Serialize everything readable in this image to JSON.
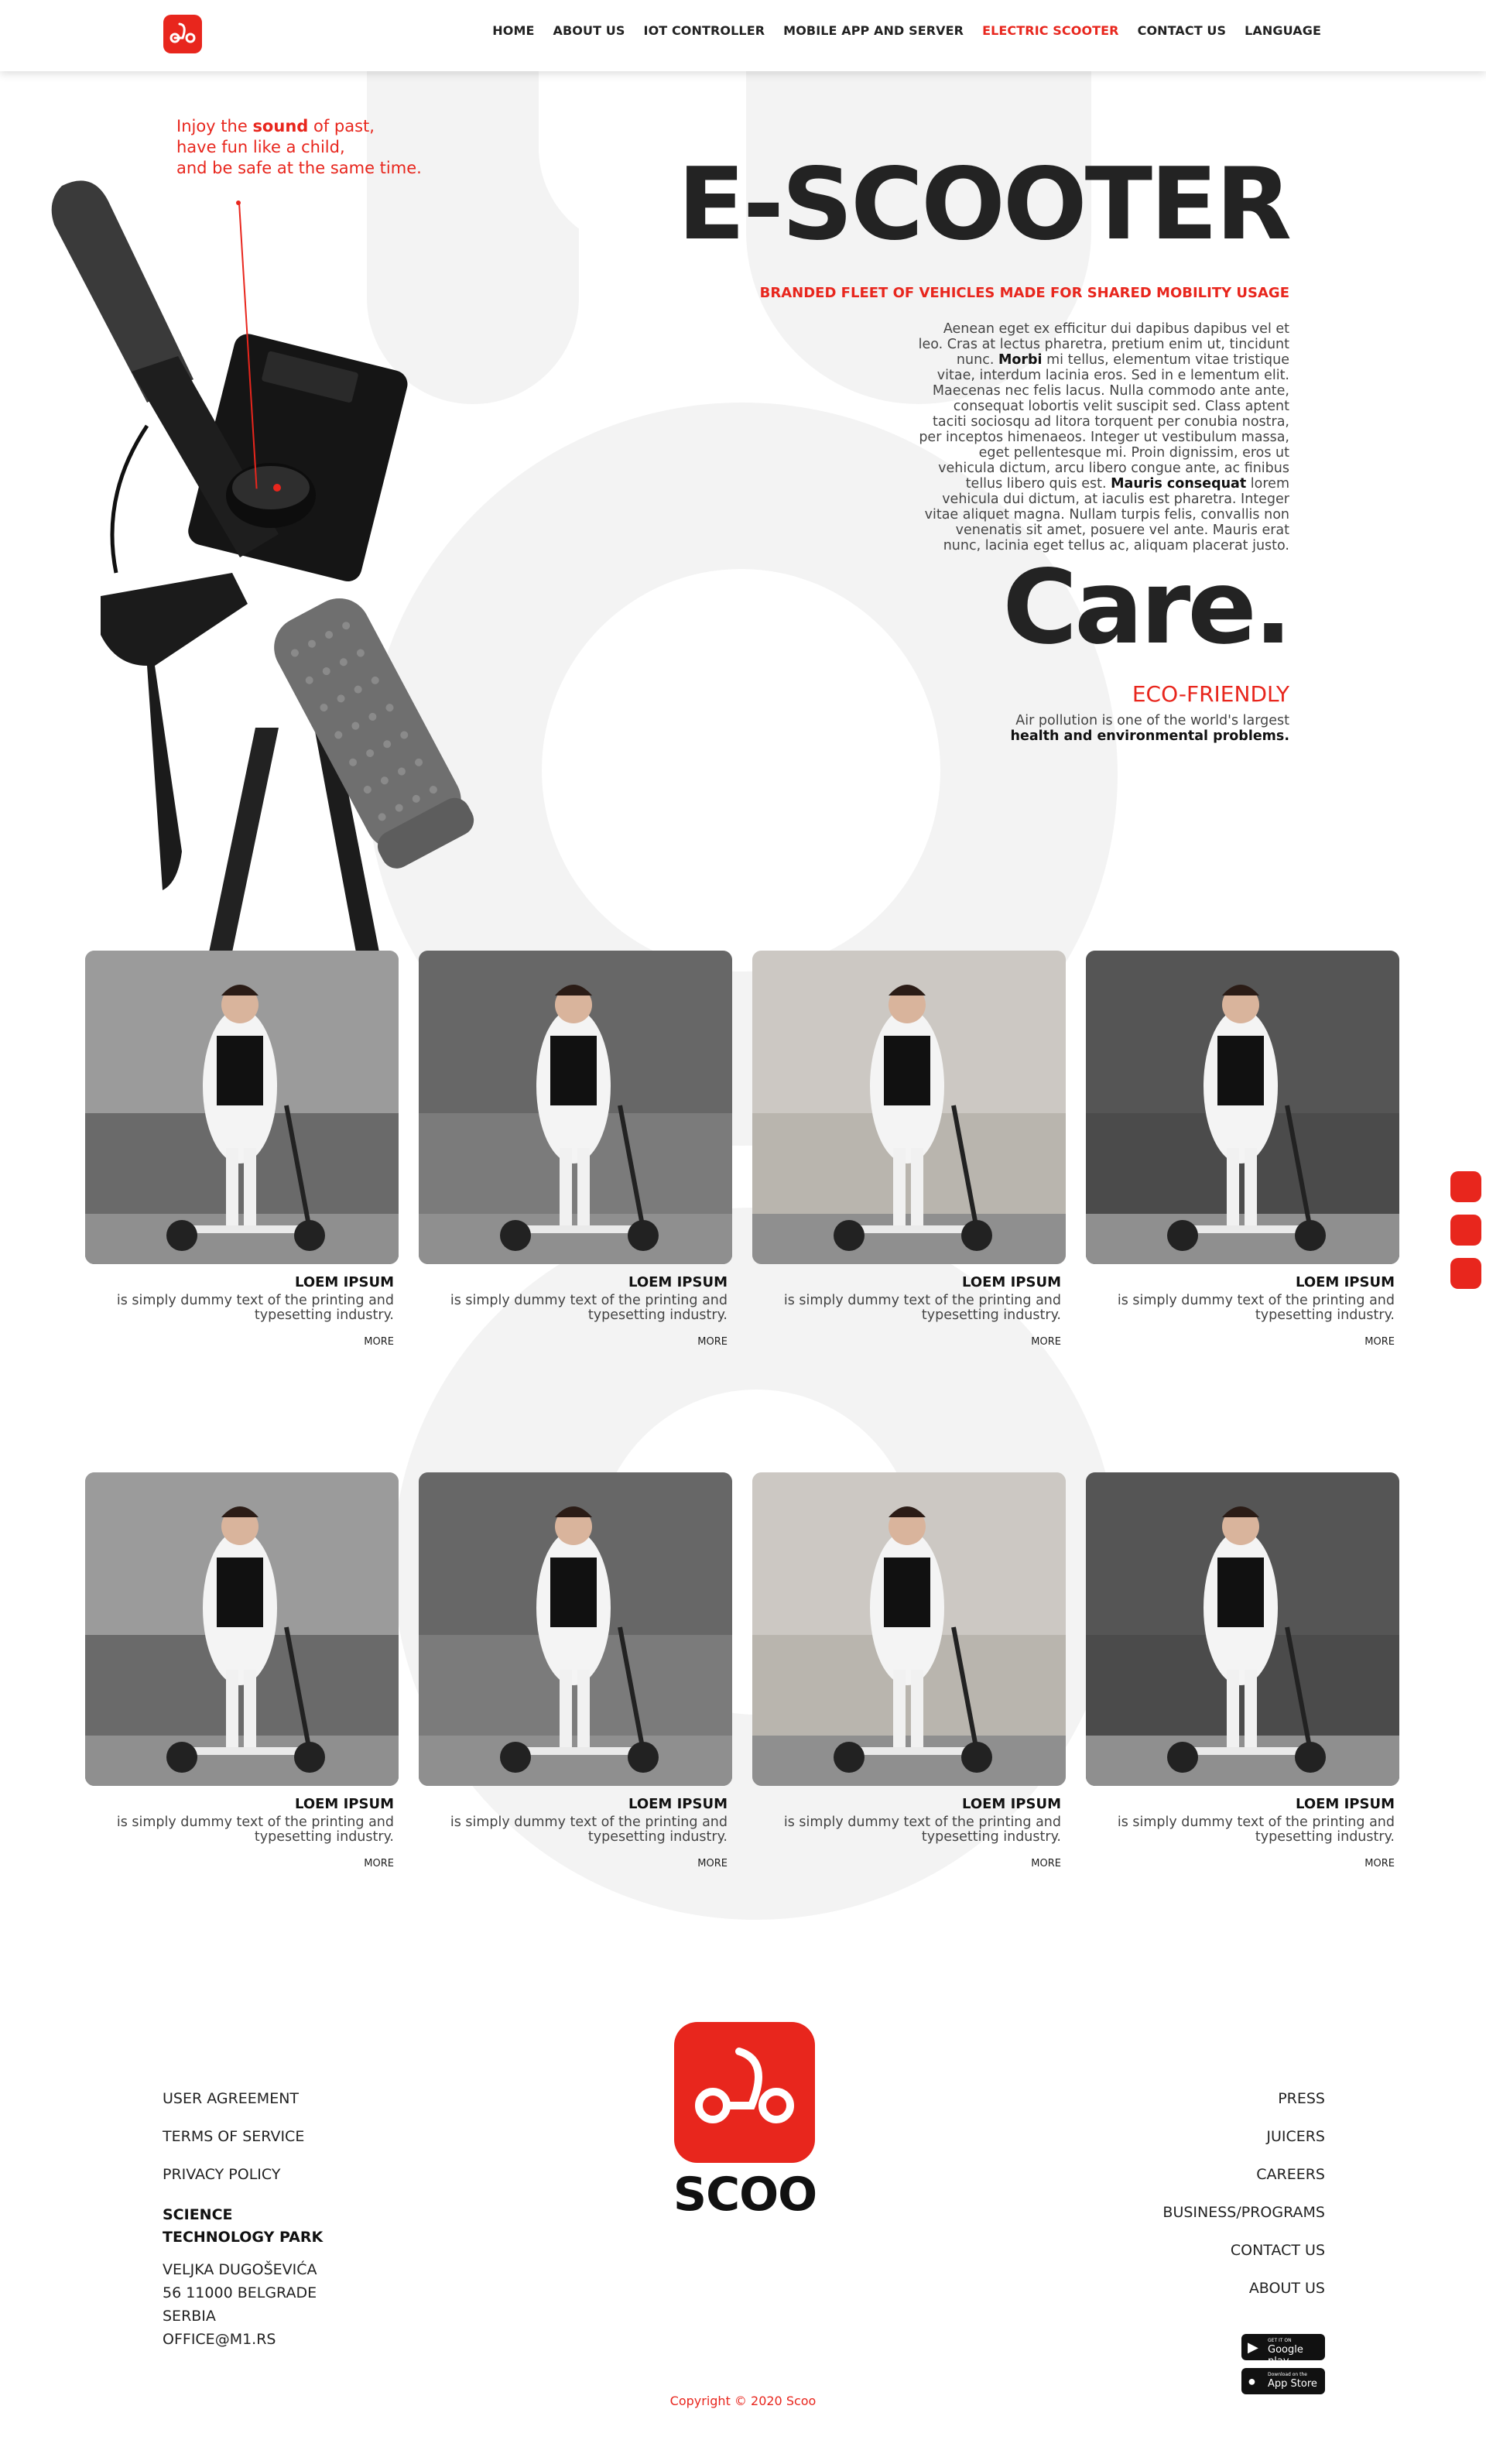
{
  "nav": [
    "HOME",
    "ABOUT US",
    "IOT CONTROLLER",
    "MOBILE APP AND SERVER",
    "ELECTRIC SCOOTER",
    "CONTACT US",
    "LANGUAGE"
  ],
  "nav_active": "ELECTRIC SCOOTER",
  "colors": {
    "accent": "#e8261d",
    "text": "#232323",
    "watermark": "#f3f3f3"
  },
  "tagline": {
    "line1_pre": "Injoy the ",
    "line1_bold": "sound",
    "line1_post": " of past,",
    "line2": "have fun like a child,",
    "line3": "and be safe at the same time."
  },
  "hero": {
    "title": "E-SCOOTER",
    "subtitle": "BRANDED FLEET OF VEHICLES MADE FOR SHARED MOBILITY USAGE",
    "p1": "Aenean eget ex efficitur dui dapibus dapibus vel et leo. Cras at lectus pharetra, pretium enim ut, tincidunt nunc. ",
    "p1_bold": "Morbi",
    "p2": " mi tellus, elementum vitae tristique vitae, interdum lacinia eros. Sed in e lementum elit. Maecenas nec felis lacus. Nulla commodo ante ante, consequat lobortis velit suscipit sed. Class aptent taciti sociosqu ad litora torquent per conubia nostra, per inceptos himenaeos. Integer ut vestibulum massa, eget pellentesque mi. Proin dignissim, eros ut vehicula dictum, arcu libero congue ante, ac finibus tellus libero quis est. ",
    "p2_bold": "Mauris consequat",
    "p3": " lorem vehicula dui dictum, at iaculis est pharetra. Integer vitae aliquet magna. Nullam turpis felis, convallis non venenatis sit amet, posuere vel ante. Mauris erat nunc, lacinia eget tellus ac, aliquam placerat justo."
  },
  "care": {
    "title": "Care.",
    "subtitle": "ECO-FRIENDLY",
    "text": "Air pollution is one of the world's largest ",
    "text_bold": "health and environmental problems."
  },
  "cards": {
    "title": "LOEM IPSUM",
    "desc": "is simply dummy text of the printing and typesetting industry.",
    "more": "MORE"
  },
  "footer": {
    "left_links": [
      "USER AGREEMENT",
      "TERMS OF SERVICE",
      "PRIVACY POLICY"
    ],
    "park_line1": "SCIENCE",
    "park_line2": "TECHNOLOGY PARK",
    "addr1": "VELJKA DUGOŠEVIĆA",
    "addr2": "56 11000 BELGRADE",
    "addr3": "SERBIA",
    "addr4": "OFFICE@M1.RS",
    "right_links": [
      "PRESS",
      "JUICERS",
      "CAREERS",
      "BUSINESS/PROGRAMS",
      "CONTACT US",
      "ABOUT US"
    ],
    "brand": "SCOO",
    "google_small": "GET IT ON",
    "google_big": "Google play",
    "apple_small": "Download on the",
    "apple_big": "App Store",
    "copyright": "Copyright © 2020 Scoo"
  }
}
